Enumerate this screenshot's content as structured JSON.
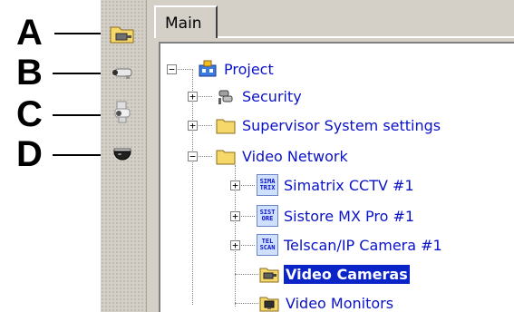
{
  "callouts": [
    {
      "letter": "A",
      "target": "folder-camera-icon"
    },
    {
      "letter": "B",
      "target": "bullet-camera-icon"
    },
    {
      "letter": "C",
      "target": "ptz-camera-icon"
    },
    {
      "letter": "D",
      "target": "dome-camera-icon"
    }
  ],
  "tabs": {
    "main_label": "Main"
  },
  "tree": {
    "project": {
      "label": "Project"
    },
    "security": {
      "label": "Security"
    },
    "supervisor": {
      "label": "Supervisor System settings"
    },
    "video_network": {
      "label": "Video Network"
    },
    "simatrix": {
      "label": "Simatrix CCTV #1",
      "icon_text": [
        "SIMA",
        "TRIX"
      ]
    },
    "sistore": {
      "label": "Sistore MX Pro #1",
      "icon_text": [
        "SIST",
        "ORE"
      ]
    },
    "telscan": {
      "label": "Telscan/IP Camera #1",
      "icon_text": [
        "TEL",
        "SCAN"
      ]
    },
    "video_cameras": {
      "label": "Video Cameras",
      "selected": true
    },
    "video_monitors": {
      "label": "Video Monitors"
    }
  },
  "colors": {
    "tree_text": "#0a12c8",
    "selection": "#0a24c8",
    "panel": "#d4d0c8",
    "folder": "#f6d76a"
  }
}
